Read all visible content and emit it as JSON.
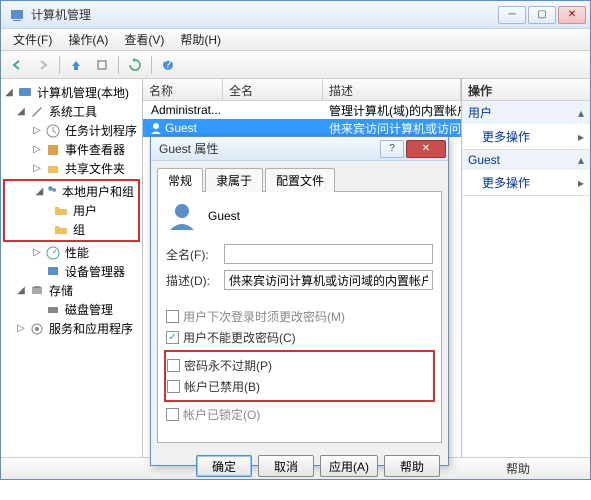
{
  "window": {
    "title": "计算机管理"
  },
  "menu": {
    "file": "文件(F)",
    "action": "操作(A)",
    "view": "查看(V)",
    "help": "帮助(H)"
  },
  "tree": {
    "root": "计算机管理(本地)",
    "system_tools": "系统工具",
    "task_scheduler": "任务计划程序",
    "event_viewer": "事件查看器",
    "shared_folders": "共享文件夹",
    "local_users_groups": "本地用户和组",
    "users": "用户",
    "groups": "组",
    "performance": "性能",
    "device_manager": "设备管理器",
    "storage": "存储",
    "disk_management": "磁盘管理",
    "services_apps": "服务和应用程序"
  },
  "list": {
    "col_name": "名称",
    "col_fullname": "全名",
    "col_desc": "描述",
    "rows": [
      {
        "name": "Administrat...",
        "fullname": "",
        "desc": "管理计算机(域)的内置帐户"
      },
      {
        "name": "Guest",
        "fullname": "",
        "desc": "供来宾访问计算机或访问域的内"
      }
    ]
  },
  "actions": {
    "header": "操作",
    "section1": "用户",
    "more1": "更多操作",
    "section2": "Guest",
    "more2": "更多操作"
  },
  "dialog": {
    "title": "Guest 属性",
    "tab_general": "常规",
    "tab_memberof": "隶属于",
    "tab_profile": "配置文件",
    "username": "Guest",
    "fullname_label": "全名(F):",
    "fullname_value": "",
    "desc_label": "描述(D):",
    "desc_value": "供来宾访问计算机或访问域的内置帐户",
    "chk_must_change": "用户下次登录时须更改密码(M)",
    "chk_cannot_change": "用户不能更改密码(C)",
    "chk_never_expire": "密码永不过期(P)",
    "chk_disabled": "帐户已禁用(B)",
    "chk_locked": "帐户已锁定(O)",
    "btn_ok": "确定",
    "btn_cancel": "取消",
    "btn_apply": "应用(A)",
    "btn_help": "帮助"
  },
  "statusbar": {
    "help": "帮助"
  }
}
